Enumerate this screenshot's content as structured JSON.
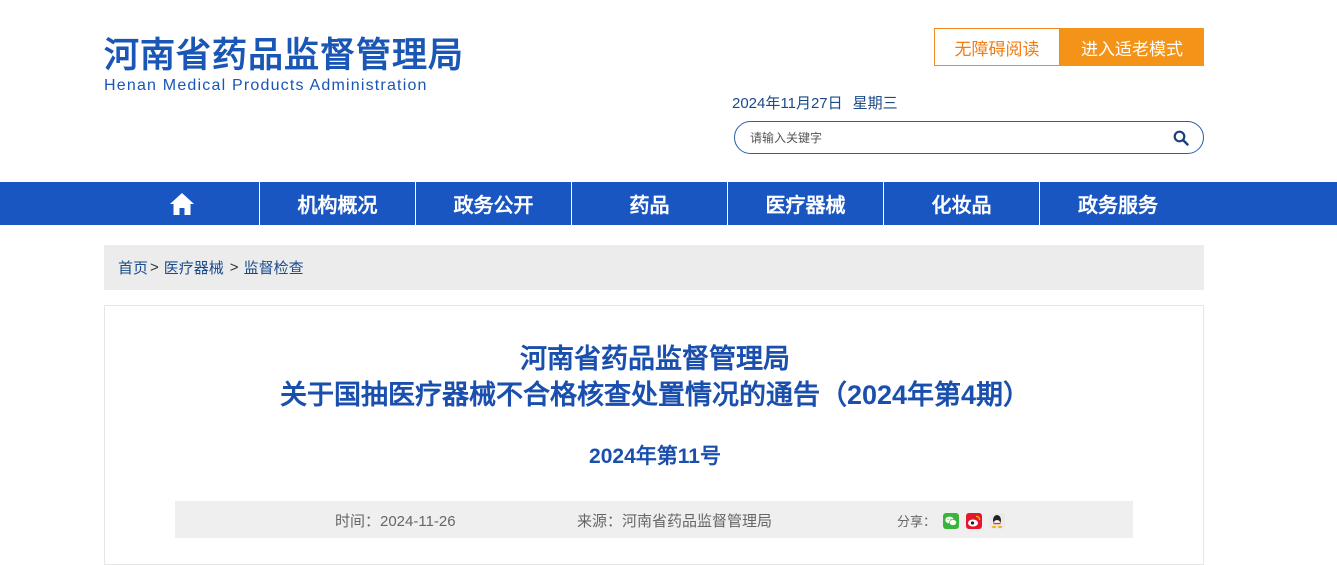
{
  "header": {
    "title_cn": "河南省药品监督管理局",
    "title_en": "Henan Medical Products Administration",
    "accessibility_label": "无障碍阅读",
    "elder_mode_label": "进入适老模式",
    "date": "2024年11月27日",
    "weekday": "星期三",
    "search": {
      "placeholder": "请输入关键字",
      "value": ""
    }
  },
  "nav": {
    "items": [
      {
        "label": "机构概况"
      },
      {
        "label": "政务公开"
      },
      {
        "label": "药品"
      },
      {
        "label": "医疗器械"
      },
      {
        "label": "化妆品"
      },
      {
        "label": "政务服务"
      }
    ],
    "home_icon": "home-icon"
  },
  "breadcrumb": {
    "home": "首页",
    "level1": "医疗器械",
    "level2": "监督检查",
    "separator": ">"
  },
  "article": {
    "title_line1": "河南省药品监督管理局",
    "title_line2": "关于国抽医疗器械不合格核查处置情况的通告（2024年第4期）",
    "doc_number": "2024年第11号",
    "time_label": "时间：2024-11-26",
    "source_label": "来源：河南省药品监督管理局",
    "share_label": "分享：",
    "share_icons": [
      "wechat-icon",
      "weibo-icon",
      "qq-icon"
    ]
  },
  "colors": {
    "brand_blue": "#1a56c2",
    "title_blue": "#1a4fae",
    "accent_orange": "#f39419"
  }
}
